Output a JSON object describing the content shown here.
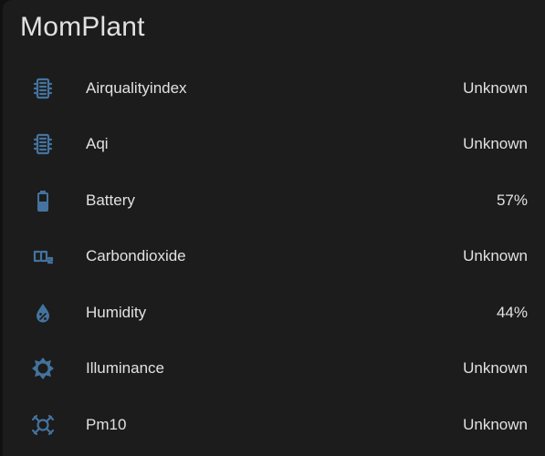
{
  "card": {
    "title": "MomPlant"
  },
  "entities": [
    {
      "name": "Airqualityindex",
      "state": "Unknown",
      "icon": "air-filter-icon"
    },
    {
      "name": "Aqi",
      "state": "Unknown",
      "icon": "air-filter-icon"
    },
    {
      "name": "Battery",
      "state": "57%",
      "icon": "battery-icon"
    },
    {
      "name": "Carbondioxide",
      "state": "Unknown",
      "icon": "molecule-co2-icon"
    },
    {
      "name": "Humidity",
      "state": "44%",
      "icon": "water-percent-icon"
    },
    {
      "name": "Illuminance",
      "state": "Unknown",
      "icon": "brightness-icon"
    },
    {
      "name": "Pm10",
      "state": "Unknown",
      "icon": "virus-icon"
    }
  ],
  "colors": {
    "icon": "#44739e",
    "text": "#e1e1e1",
    "card_background": "#1c1c1c",
    "page_background": "#111111"
  }
}
